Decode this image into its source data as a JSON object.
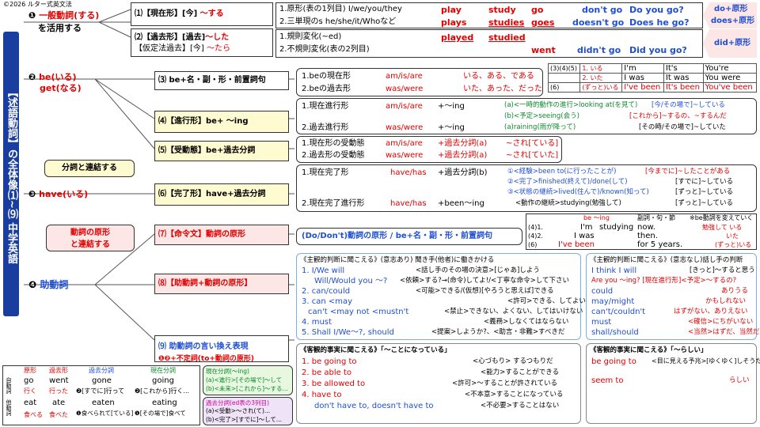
{
  "copyright": "©2026 ルター式英文法",
  "side_title": "【述語動詞】の全体像⑴~⑼ 中学英語",
  "sections": {
    "s1": {
      "num": "❶",
      "label_a": "一般動詞(する)",
      "label_b": "を活用する"
    },
    "s2": {
      "num": "❷",
      "label_a": "be(いる)",
      "label_b": "get(なる)"
    },
    "s3": {
      "num": "❸",
      "label": "have(いる)"
    },
    "s4": {
      "num": "❹",
      "label": "助動詞"
    }
  },
  "connect_participle": "分詞と連結する",
  "connect_base": [
    "動詞の原形",
    "と連結する"
  ],
  "items": {
    "i1": {
      "label": "⑴【現在形】[今]",
      "suffix": "〜する"
    },
    "i2": {
      "label_a": "⑵【過去形】[過去]",
      "suffix_a": "〜した",
      "label_b": "【仮定法過去】[今]",
      "suffix_b": "〜たら"
    },
    "i3": {
      "label": "⑶ be+名・副・形・前置詞句"
    },
    "i4": {
      "label": "⑷【進行形】be+ 〜ing"
    },
    "i5": {
      "label": "⑸【受動態】be+過去分詞"
    },
    "i6": {
      "label": "⑹【完了形】have+過去分詞"
    },
    "i7": {
      "label": "⑺【命令文】動詞の原形"
    },
    "i8": {
      "label": "⑻【助動詞+動詞の原形】"
    },
    "i9": {
      "label_a": "⑼ 助動詞の言い換え表現",
      "label_b": "❶❷+不定詞(to+動詞の原形)"
    }
  },
  "row1": {
    "l1": "1.原形(表の1列目) I/we/you/they",
    "l2": "2.三単現のs he/she/it/Whoなど",
    "play": "play",
    "study": "study",
    "go": "go",
    "dont": "don't go",
    "do_you": "Do you go?",
    "plays": "plays",
    "studies": "studies",
    "goes": "goes",
    "doesnt": "doesn't go",
    "does_he": "Does he go?",
    "tag1": "do+原形",
    "tag2": "does+原形"
  },
  "row2": {
    "l1": "1.規則変化(~ed)",
    "l2": "2.不規則変化(表の2列目)",
    "played": "played",
    "studied": "studied",
    "went": "went",
    "didnt": "didn't go",
    "did_you": "Did you go?",
    "tag": "did+原形"
  },
  "row3": {
    "l1": "1.beの現在形",
    "v1": "am/is/are",
    "m1": "いる、ある、である",
    "l2": "2.beの過去形",
    "v2": "was/were",
    "m2": "いた、あった、だった"
  },
  "be_table": [
    [
      "(3)(4)(5)",
      "1. いる",
      "I'm",
      "It's",
      "You're"
    ],
    [
      "",
      "2. いた",
      "I was",
      "It was",
      "You were"
    ],
    [
      "(6)",
      "(ずっと)いる",
      "I've been",
      "It's been",
      "You've been"
    ]
  ],
  "row4": {
    "l1": "1.現在進行形",
    "v1": "am/is/are",
    "p1": "+〜ing",
    "a": "(a)<一時的動作の進行>looking at(を見て)",
    "a_r": "[今/その場で]~している",
    "b": "(b)<予定>seeing(会う)",
    "b_r": "[これから]~するの、~するんだ",
    "l2": "2.過去進行形",
    "v2": "was/were",
    "p2": "+〜ing",
    "c": "(a)raining(雨が降って)",
    "c_r": "[その時/その場で]~していた"
  },
  "row5": {
    "l1": "1.現在形の受動態",
    "v1": "am/is/are",
    "p1": "+過去分詞(a)",
    "m1": "~され[ている]",
    "l2": "2.過去形の受動態",
    "v2": "was/were",
    "p2": "+過去分詞(a)",
    "m2": "~され[ていた]"
  },
  "row6": {
    "l1": "1.現在完了形",
    "v1": "have/has",
    "p1": "+過去分詞(b)",
    "e1": "①<経験>been to(に行ったことが)",
    "e1r": "[今までに]~したことがある",
    "e2": "②<完了>finished(終えて)/done(して)",
    "e2r": "[すでに]~している",
    "e3": "③<状態の継続>lived(住んで)/known(知って)",
    "e3r": "[ずっと]~している",
    "l2": "2.現在完了進行形",
    "v2": "have/has",
    "p2": "+been〜ing",
    "e4": "<動作の継続>studying(勉強して)",
    "e4r": "[ずっと]~している"
  },
  "ing_table": {
    "head": [
      "be 〜ing",
      "副詞・句・節",
      "※be動詞を変えていく"
    ],
    "rows": [
      [
        "(4)1.",
        "I'm",
        "studying",
        "now.",
        "勉強して いる"
      ],
      [
        "(4)2.",
        "I was",
        "",
        "then.",
        "いた"
      ],
      [
        "(6)",
        "I've been",
        "",
        "for 5 years.",
        "(ずっと)いる"
      ]
    ]
  },
  "row7": {
    "text": "(Do/Don't)動詞の原形 / be+名・副・形・前置詞句"
  },
  "row8_left": {
    "header": "《主観的判断に聞こえる》(意志あり) 聞き手(他者)に働きかける",
    "lines": [
      [
        "1. I/We will",
        "<話し手のその場の決意>[じゃあ]しよう"
      ],
      [
        "Will/Would you 〜?",
        "<依頼>する?→(命令)してよ!/<丁寧な命令>して下さい"
      ],
      [
        "2. can/could",
        "<可能>できる/(仮想)[やろうと思えば]できる"
      ],
      [
        "3. can <may",
        "<許可>できる、してよい"
      ],
      [
        "can't <may not <mustn't",
        "<禁止>できない、よくない、してはいけない"
      ],
      [
        "4. must",
        "<義務>しなくてはならない"
      ],
      [
        "5. Shall I/We〜?, should",
        "<提案>しようか?、<助言・非難>すべきだ"
      ]
    ]
  },
  "row8_right": {
    "header": "《主観的判断に聞こえる》(意志なし)話し手の判断",
    "lines": [
      [
        "I think I will",
        "[きっと]〜すると思う"
      ],
      [
        "Are you 〜ing? [現在進行形]<予定>〜するの?",
        ""
      ],
      [
        "could",
        "ありうる"
      ],
      [
        "may/might",
        "かもしれない"
      ],
      [
        "can't/couldn't",
        "はずがない、ありえない"
      ],
      [
        "must",
        "<確信>にちがいない"
      ],
      [
        "shall/should",
        "<当然>はずだ、当然だ"
      ]
    ]
  },
  "row9_left": {
    "header": "《客観的事実に聞こえる》「〜ことになっている」",
    "lines": [
      [
        "1. be going to",
        "<心づもり> するつもりだ"
      ],
      [
        "2. be able to",
        "<能力>することができる"
      ],
      [
        "3. be allowed to",
        "<許可>〜することが許されている"
      ],
      [
        "4. have to",
        "<不本意>することになっている"
      ],
      [
        "don't have to, doesn't have to",
        "<不必要>することはない"
      ]
    ]
  },
  "row9_right": {
    "header": "《客観的事実に聞こえる》「〜らしい」",
    "lines": [
      [
        "be going to",
        "<目に見える予兆>[ゆくゆく]しそうだ"
      ],
      [
        "seem to",
        "らしい"
      ]
    ]
  },
  "verb_table": {
    "head": [
      "原形",
      "過去形",
      "過去分詞",
      "現在分詞"
    ],
    "side1": "自動詞",
    "side2": "他動詞",
    "r1": [
      "go",
      "went",
      "gone",
      "going"
    ],
    "r1j": [
      "行く",
      "行った",
      "❷[すでに]行って",
      "❷[これから]行く..."
    ],
    "r2": [
      "eat",
      "ate",
      "eaten",
      "eating"
    ],
    "r2j": [
      "食べる",
      "食べた",
      "❶食べられて[ている]",
      "❶[その場で]食べて"
    ]
  },
  "present_participle": {
    "title": "現在分詞(〜ing)",
    "a": "(a)<進行>[その場で]〜して",
    "b": "(b)<未来>[これから]〜する..."
  },
  "past_participle": {
    "title": "過去分詞(ed表の3列目)",
    "a": "(a)<受動>〜され(て)...",
    "b": "(b)<完了>[すでに]〜して..."
  }
}
